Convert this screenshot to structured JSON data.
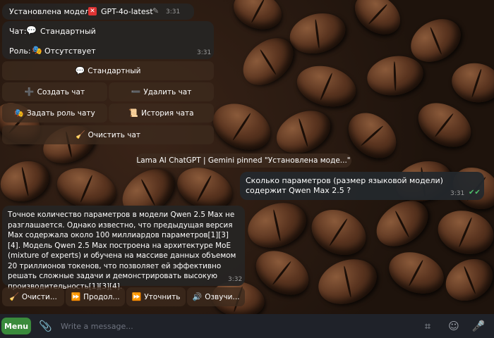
{
  "top_message": {
    "label": "Установлена модель:",
    "model_icon": "red-square-x-icon",
    "model_name": "GPT-4o-latest",
    "time": "3:31"
  },
  "info_message": {
    "chat_label": "Чат:",
    "chat_value": "Стандартный",
    "role_label": "Роль:",
    "role_value": "Отсутствует",
    "time": "3:31"
  },
  "keyboard": {
    "standard": "Стандартный",
    "create_chat": "Создать чат",
    "delete_chat": "Удалить чат",
    "set_role": "Задать роль чату",
    "history": "История чата",
    "clear_chat": "Очистить чат"
  },
  "pinned": {
    "text": "Lama AI ChatGPT | Gemini pinned \"Установлена моде...\""
  },
  "question": {
    "text": "Сколько параметров (размер языковой модели) содержит Qwen Max 2.5 ?",
    "time": "3:31"
  },
  "answer": {
    "text": "Точное количество параметров в модели Qwen 2.5 Max не разглашается. Однако известно, что предыдущая версия Max содержала около 100 миллиардов параметров[1][3][4]. Модель Qwen 2.5 Max построена на архитектуре MoE (mixture of experts) и обучена на массиве данных объемом 20 триллионов токенов, что позволяет ей эффективно решать сложные задачи и демонстрировать высокую производительность[1][3][4].",
    "time": "3:32"
  },
  "answer_buttons": {
    "clear": "Очисти...",
    "continue": "Продол...",
    "clarify": "Уточнить",
    "voice": "Озвучи..."
  },
  "bottom_bar": {
    "menu": "Menu",
    "placeholder": "Write a message..."
  },
  "colors": {
    "menu_green": "#3a8b3c",
    "bubble_dark": "#262524",
    "check_green": "#4fbf6a"
  }
}
